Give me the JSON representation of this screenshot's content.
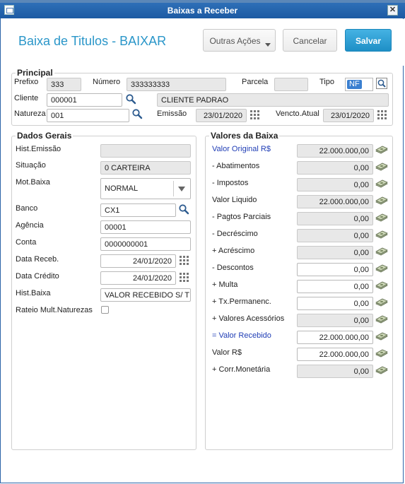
{
  "window": {
    "title": "Baixas a Receber"
  },
  "header": {
    "page_title": "Baixa de Titulos - BAIXAR",
    "actions_label": "Outras Ações",
    "cancel_label": "Cancelar",
    "save_label": "Salvar"
  },
  "principal": {
    "title": "Principal",
    "prefixo_label": "Prefixo",
    "prefixo": "333",
    "numero_label": "Número",
    "numero": "333333333",
    "parcela_label": "Parcela",
    "parcela": "",
    "tipo_label": "Tipo",
    "tipo": "NF",
    "cliente_label": "Cliente",
    "cliente": "000001",
    "cliente_nome": "CLIENTE PADRAO",
    "natureza_label": "Natureza",
    "natureza": "001",
    "emissao_label": "Emissão",
    "emissao": "23/01/2020",
    "vencto_label": "Vencto.Atual",
    "vencto": "23/01/2020"
  },
  "dados": {
    "title": "Dados Gerais",
    "hist_emissao_label": "Hist.Emissão",
    "hist_emissao": "",
    "situacao_label": "Situação",
    "situacao": "0 CARTEIRA",
    "mot_baixa_label": "Mot.Baixa",
    "mot_baixa": "NORMAL",
    "banco_label": "Banco",
    "banco": "CX1",
    "agencia_label": "Agência",
    "agencia": "00001",
    "conta_label": "Conta",
    "conta": "0000000001",
    "data_receb_label": "Data Receb.",
    "data_receb": "24/01/2020",
    "data_credito_label": "Data Crédito",
    "data_credito": "24/01/2020",
    "hist_baixa_label": "Hist.Baixa",
    "hist_baixa": "VALOR RECEBIDO S/ TITULO",
    "rateio_label": "Rateio Mult.Naturezas"
  },
  "valores": {
    "title": "Valores da Baixa",
    "rows": [
      {
        "label": "Valor Original R$",
        "value": "22.000.000,00",
        "readonly": true
      },
      {
        "label": "- Abatimentos",
        "value": "0,00",
        "readonly": true
      },
      {
        "label": "- Impostos",
        "value": "0,00",
        "readonly": true
      },
      {
        "label": "Valor Liquido",
        "value": "22.000.000,00",
        "readonly": true
      },
      {
        "label": "- Pagtos Parciais",
        "value": "0,00",
        "readonly": true
      },
      {
        "label": "- Decréscimo",
        "value": "0,00",
        "readonly": true
      },
      {
        "label": "+ Acréscimo",
        "value": "0,00",
        "readonly": true
      },
      {
        "label": "- Descontos",
        "value": "0,00",
        "readonly": false
      },
      {
        "label": "+ Multa",
        "value": "0,00",
        "readonly": false
      },
      {
        "label": "+ Tx.Permanenc.",
        "value": "0,00",
        "readonly": false
      },
      {
        "label": "+ Valores Acessórios",
        "value": "0,00",
        "readonly": true
      },
      {
        "label": "= Valor Recebido",
        "value": "22.000.000,00",
        "readonly": false
      },
      {
        "label": "Valor R$",
        "value": "22.000.000,00",
        "readonly": false
      },
      {
        "label": "+ Corr.Monetária",
        "value": "0,00",
        "readonly": true
      }
    ]
  },
  "colors": {
    "title_bar": "#1c5aa3",
    "accent": "#2a96c9",
    "blue_label": "#1f3db5"
  }
}
